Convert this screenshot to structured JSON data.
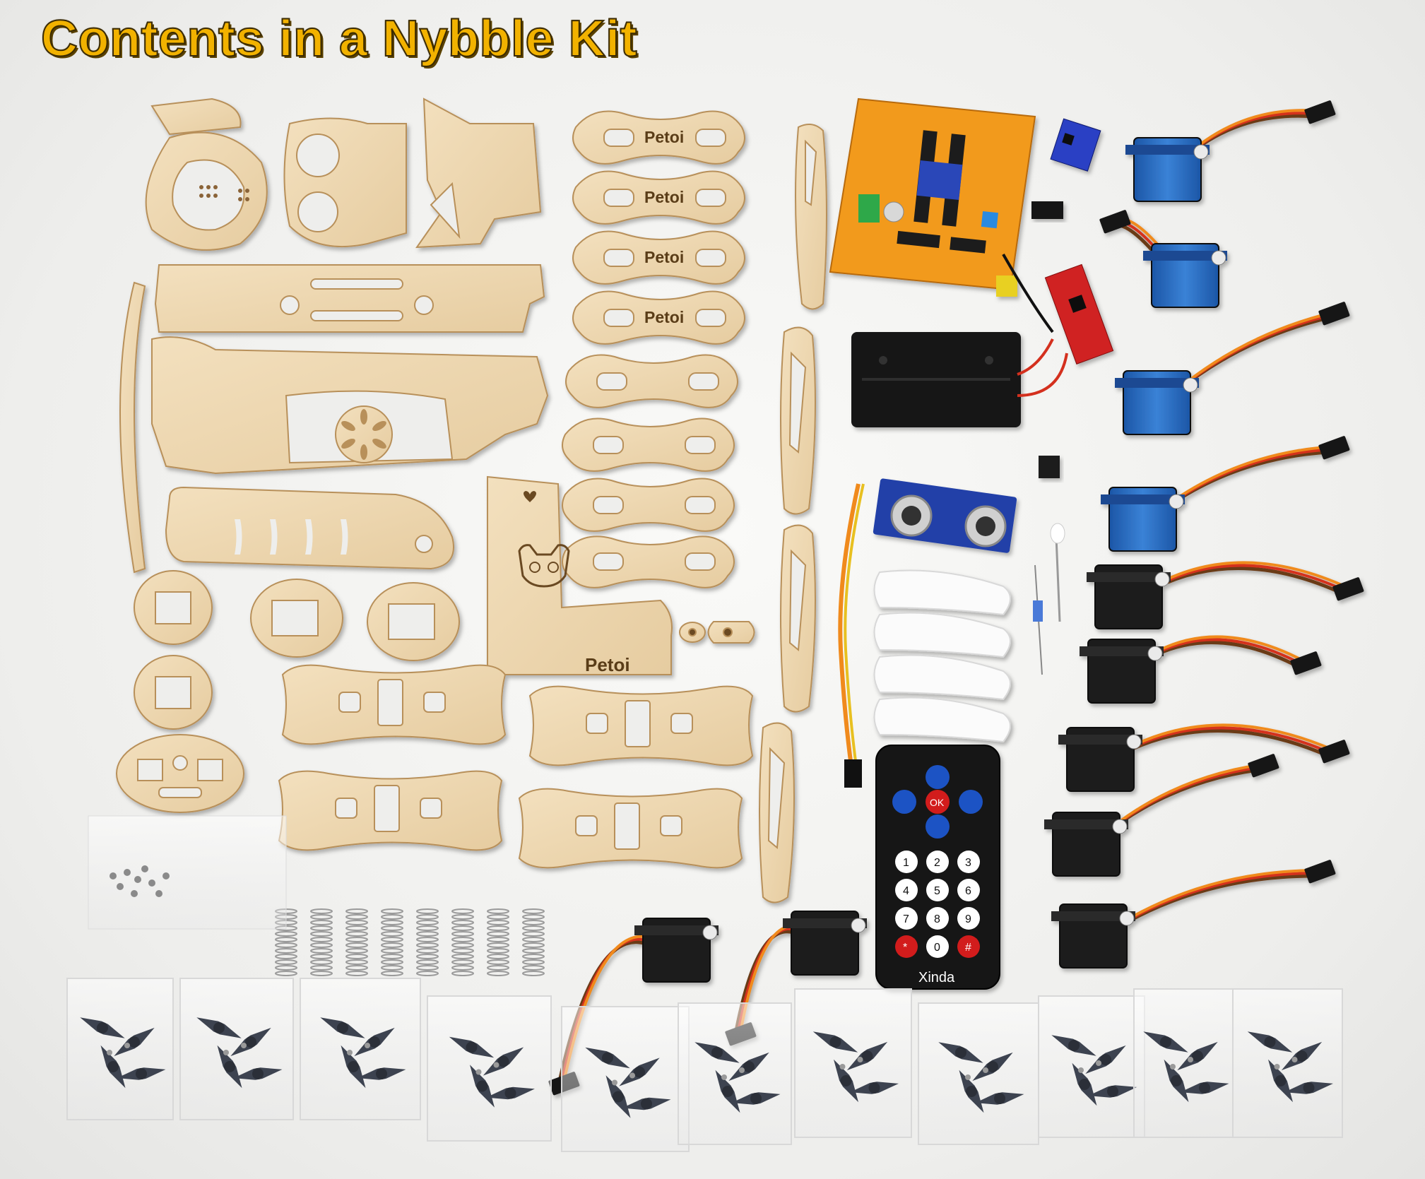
{
  "title": "Contents in a Nybble Kit",
  "labels": {
    "petoi_1": "Petoi",
    "petoi_2": "Petoi",
    "petoi_3": "Petoi",
    "petoi_4": "Petoi",
    "petoi_5": "Petoi",
    "remote_brand": "Xinda",
    "remote_ok": "OK",
    "remote_keys": [
      "1",
      "2",
      "3",
      "4",
      "5",
      "6",
      "7",
      "8",
      "9",
      "*",
      "0",
      "#"
    ]
  },
  "counts": {
    "leg_plates": 8,
    "micro_servos": 11,
    "horn_bags": 11,
    "springs": 8
  },
  "colors": {
    "title_fill": "#f2b200",
    "title_outline": "#3a2a00",
    "wood": "#efd9b3",
    "wood_edge": "#b8905a",
    "board": "#f29a1d",
    "servo_blue": "#2a6fc4",
    "servo_black": "#1e1e1e",
    "wire_orange": "#f08a1c",
    "wire_red": "#d4301e",
    "wire_brown": "#6b3a18",
    "remote_body": "#151515",
    "remote_red": "#d21f1f",
    "remote_blue": "#1f52c4"
  }
}
